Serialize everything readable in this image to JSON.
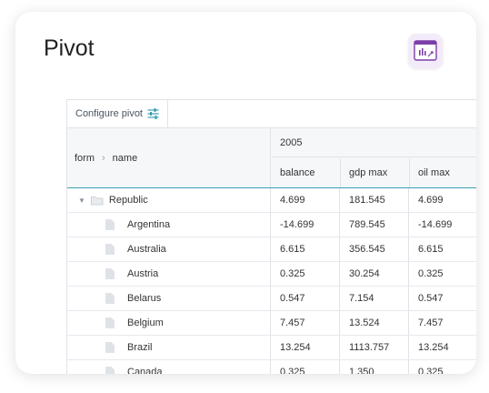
{
  "page": {
    "title": "Pivot"
  },
  "toolbar": {
    "configure_label": "Configure pivot"
  },
  "header": {
    "corner_field1": "form",
    "corner_field2": "name",
    "year": "2005",
    "columns": [
      "balance",
      "gdp max",
      "oil max"
    ]
  },
  "rows": [
    {
      "label": "Republic",
      "type": "group",
      "values": [
        "4.699",
        "181.545",
        "4.699"
      ]
    },
    {
      "label": "Argentina",
      "type": "item",
      "values": [
        "-14.699",
        "789.545",
        "-14.699"
      ]
    },
    {
      "label": "Australia",
      "type": "item",
      "values": [
        "6.615",
        "356.545",
        "6.615"
      ]
    },
    {
      "label": "Austria",
      "type": "item",
      "values": [
        "0.325",
        "30.254",
        "0.325"
      ]
    },
    {
      "label": "Belarus",
      "type": "item",
      "values": [
        "0.547",
        "7.154",
        "0.547"
      ]
    },
    {
      "label": "Belgium",
      "type": "item",
      "values": [
        "7.457",
        "13.524",
        "7.457"
      ]
    },
    {
      "label": "Brazil",
      "type": "item",
      "values": [
        "13.254",
        "1113.757",
        "13.254"
      ]
    },
    {
      "label": "Canada",
      "type": "item",
      "values": [
        "0.325",
        "1.350",
        "0.325"
      ]
    }
  ],
  "colors": {
    "accent": "#3a9fb0",
    "icon_bg": "#f3ebf9",
    "icon_purple": "#7b3fa8"
  }
}
